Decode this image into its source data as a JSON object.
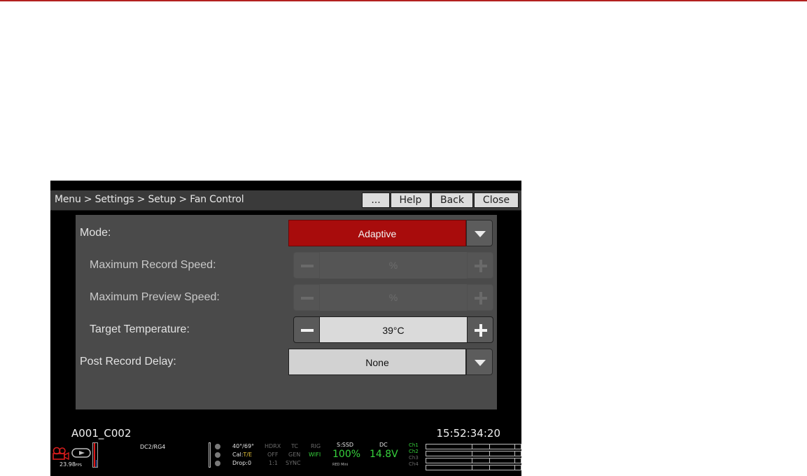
{
  "window": {
    "breadcrumb": "Menu > Settings > Setup > Fan Control",
    "buttons": {
      "more": "...",
      "help": "Help",
      "back": "Back",
      "close": "Close"
    }
  },
  "settings": {
    "mode": {
      "label": "Mode:",
      "value": "Adaptive"
    },
    "max_record_speed": {
      "label": "Maximum Record Speed:",
      "value": "%"
    },
    "max_preview_speed": {
      "label": "Maximum Preview Speed:",
      "value": "%"
    },
    "target_temperature": {
      "label": "Target Temperature:",
      "value": "39°C"
    },
    "post_record_delay": {
      "label": "Post Record Delay:",
      "value": "None"
    }
  },
  "status": {
    "clip_name": "A001_C002",
    "timecode": "15:52:34:20",
    "fps": "23.98",
    "fps_unit": "FPS",
    "look": "DC2/RG4",
    "temps": "40°/69°",
    "cal_label": "Cal:",
    "cal_value": "T/E",
    "drop": "Drop:0",
    "hdrx_label": "HDRX",
    "hdrx_value": "OFF",
    "hdrx_ratio": "1:1",
    "tc_label": "TC",
    "tc_value": "GEN",
    "tc_sync": "SYNC",
    "rig_label": "RIG",
    "rig_value": "WIFI",
    "media_label": "S:SSD",
    "media_value": "100%",
    "media_tags": "RED Mini",
    "power_label": "DC",
    "power_value": "14.8V",
    "channels": [
      "Ch1",
      "Ch2",
      "Ch3",
      "Ch4"
    ]
  },
  "colors": {
    "accent_red": "#a80c0c",
    "status_green": "#36d13c",
    "panel": "#4a4a4a"
  },
  "icons": [
    "camera-record-icon",
    "play-icon",
    "dropdown-arrow-icon",
    "minus-icon",
    "plus-icon"
  ]
}
